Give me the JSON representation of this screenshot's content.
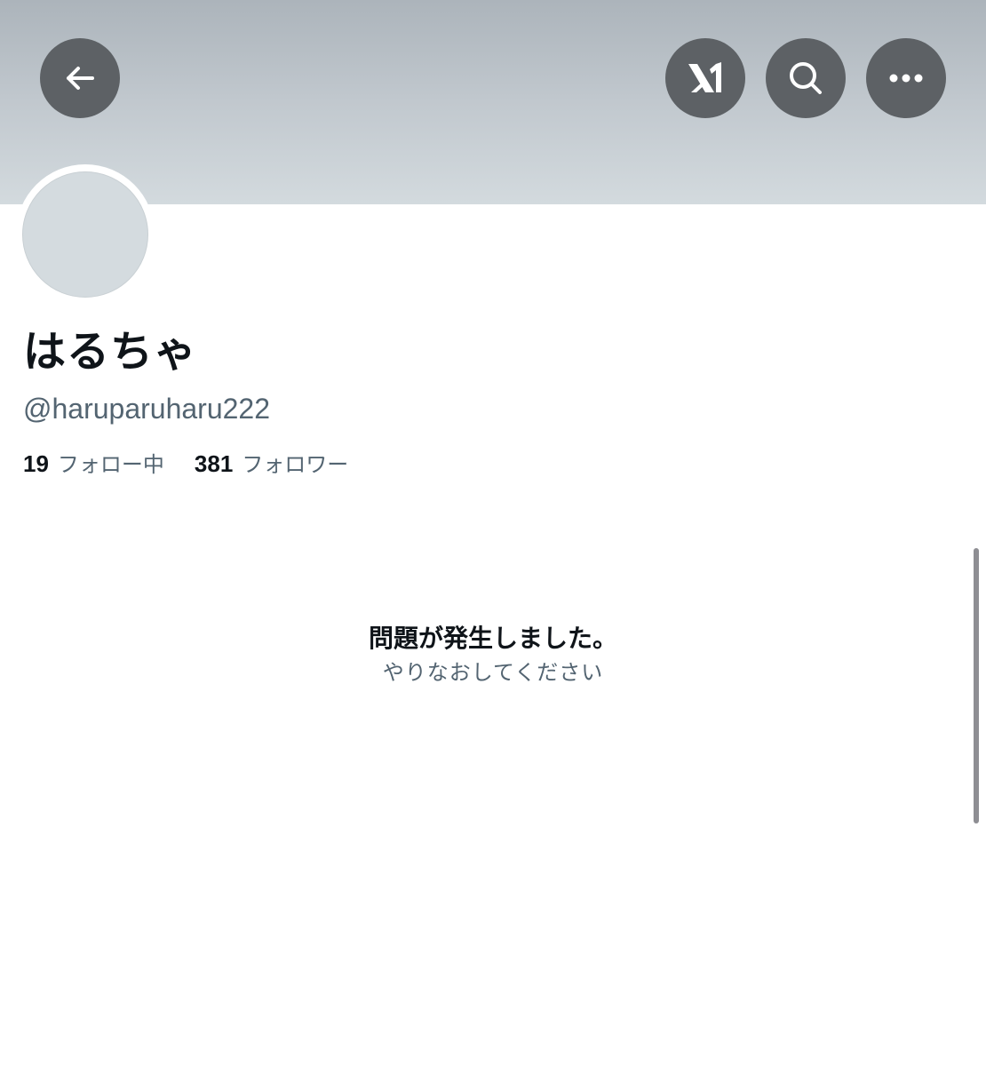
{
  "header": {
    "back_icon": "arrow-left-icon",
    "grok_icon": "grok-icon",
    "search_icon": "search-icon",
    "more_icon": "more-horizontal-icon",
    "banner_color": "#c1c8ce",
    "button_color": "#5d6165"
  },
  "profile": {
    "display_name": "はるちゃ",
    "handle": "@haruparuharu222",
    "following_count": "19",
    "following_label": "フォロー中",
    "followers_count": "381",
    "followers_label": "フォロワー",
    "avatar_color": "#d4dbdf"
  },
  "error": {
    "title": "問題が発生しました。",
    "subtitle": "やりなおしてください"
  }
}
